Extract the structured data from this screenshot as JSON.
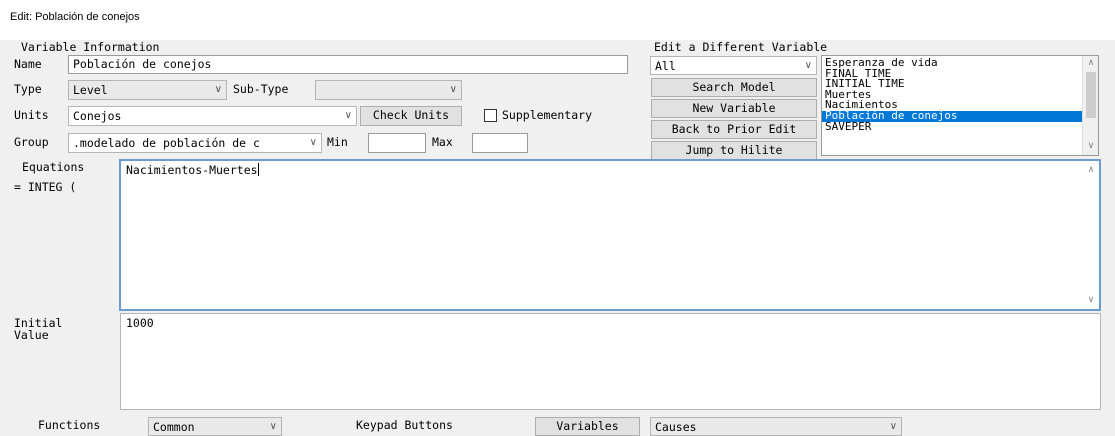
{
  "window": {
    "title": "Edit: Población de conejos"
  },
  "variable_info": {
    "section_label": "Variable Information",
    "name_label": "Name",
    "name_value": "Población de conejos",
    "type_label": "Type",
    "type_value": "Level",
    "subtype_label": "Sub-Type",
    "subtype_value": "",
    "units_label": "Units",
    "units_value": "Conejos",
    "check_units_label": "Check Units",
    "supplementary_label": "Supplementary",
    "supplementary_checked": false,
    "group_label": "Group",
    "group_value": ".modelado de población de c",
    "min_label": "Min",
    "min_value": "",
    "max_label": "Max",
    "max_value": ""
  },
  "edit_different": {
    "section_label": "Edit a Different Variable",
    "filter_value": "All",
    "search_model_label": "Search Model",
    "new_variable_label": "New Variable",
    "back_prior_label": "Back to Prior Edit",
    "jump_hilite_label": "Jump to Hilite",
    "variables": [
      "Esperanza de vida",
      "FINAL TIME",
      "INITIAL TIME",
      "Muertes",
      "Nacimientos",
      "Población de conejos",
      "SAVEPER"
    ],
    "selected_variable": "Población de conejos"
  },
  "equations": {
    "label": "Equations",
    "integ_label": "= INTEG (",
    "value": "Nacimientos-Muertes"
  },
  "initial_value": {
    "label_line1": "Initial",
    "label_line2": "Value",
    "value": "1000"
  },
  "bottom_bar": {
    "functions_label": "Functions",
    "functions_value": "Common",
    "keypad_label": "Keypad Buttons",
    "variables_button_label": "Variables",
    "causes_value": "Causes"
  },
  "colors": {
    "selection": "#0078d7",
    "focus_border": "#6c9bd2",
    "window_bg": "#f0f0f0"
  }
}
